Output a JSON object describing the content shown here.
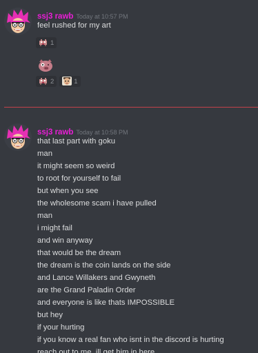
{
  "messages": [
    {
      "username": "ssj3 rawb",
      "timestamp": "Today at 10:57 PM",
      "lines": [
        "feel rushed for my art"
      ],
      "reactions_row1": [
        {
          "icon": "pixel-pig-emoji",
          "count": "1"
        }
      ],
      "standalone_emoji": "pig-face-emoji",
      "reactions_row2": [
        {
          "icon": "pixel-pig-emoji",
          "count": "2"
        },
        {
          "icon": "face-emoji",
          "count": "1"
        }
      ]
    },
    {
      "username": "ssj3 rawb",
      "timestamp": "Today at 10:58 PM",
      "lines": [
        "that last part with goku",
        "man",
        "it might seem so weird",
        "to root for yourself to fail",
        "but when you see",
        "the wholesome scam i have pulled",
        "man",
        "i might fail",
        "and win anyway",
        "that would be the dream",
        "the dream is the coin lands on the side",
        "and Lance Willakers and Gwyneth",
        "are the Grand Paladin Order",
        "and everyone is like thats IMPOSSIBLE",
        "but hey",
        "if your hurting",
        "if you know a real fan who isnt in the discord is hurting",
        "reach out to me, ill get him in here"
      ]
    }
  ],
  "colors": {
    "background": "#36393f",
    "username": "#e91ed6",
    "text": "#dcddde",
    "timestamp": "#72767d",
    "new_messages_divider": "#c3424c"
  }
}
